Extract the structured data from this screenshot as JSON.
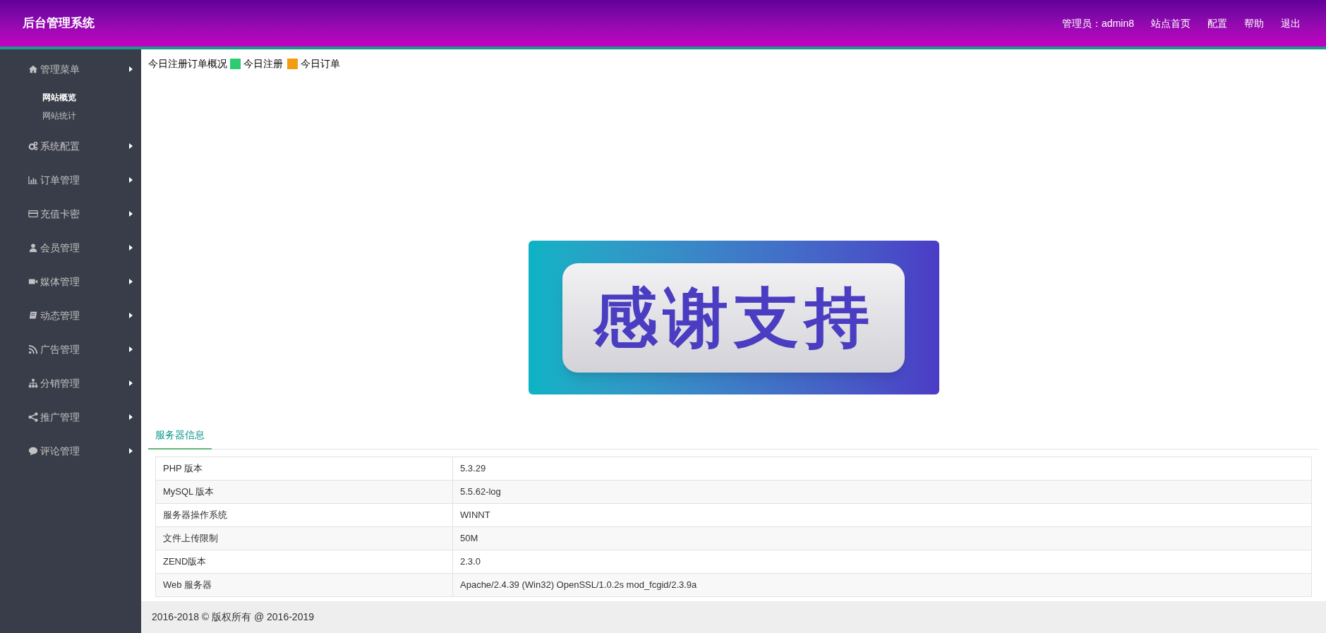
{
  "header": {
    "title": "后台管理系统",
    "admin_label": "管理员：admin8",
    "links": [
      "站点首页",
      "配置",
      "帮助",
      "退出"
    ]
  },
  "sidebar": {
    "items": [
      {
        "label": "管理菜单",
        "children": [
          {
            "label": "网站概览",
            "selected": true
          },
          {
            "label": "网站统计",
            "selected": false
          }
        ]
      },
      {
        "label": "系统配置"
      },
      {
        "label": "订单管理"
      },
      {
        "label": "充值卡密"
      },
      {
        "label": "会员管理"
      },
      {
        "label": "媒体管理"
      },
      {
        "label": "动态管理"
      },
      {
        "label": "广告管理"
      },
      {
        "label": "分销管理"
      },
      {
        "label": "推广管理"
      },
      {
        "label": "评论管理"
      }
    ]
  },
  "chart": {
    "title": "今日注册订单概况",
    "legend": [
      {
        "label": "今日注册",
        "color": "#2ecc71"
      },
      {
        "label": "今日订单",
        "color": "#f39c12"
      }
    ]
  },
  "banner": {
    "text": "感谢支持"
  },
  "tabs": [
    {
      "label": "服务器信息",
      "selected": true
    }
  ],
  "server_table": {
    "rows": [
      [
        "PHP 版本",
        "5.3.29"
      ],
      [
        "MySQL 版本",
        "5.5.62-log"
      ],
      [
        "服务器操作系统",
        "WINNT"
      ],
      [
        "文件上传限制",
        "50M"
      ],
      [
        "ZEND版本",
        "2.3.0"
      ],
      [
        "Web 服务器",
        "Apache/2.4.39 (Win32) OpenSSL/1.0.2s mod_fcgid/2.3.9a"
      ]
    ]
  },
  "footer": {
    "text": "2016-2018 © 版权所有 @ 2016-2019"
  }
}
